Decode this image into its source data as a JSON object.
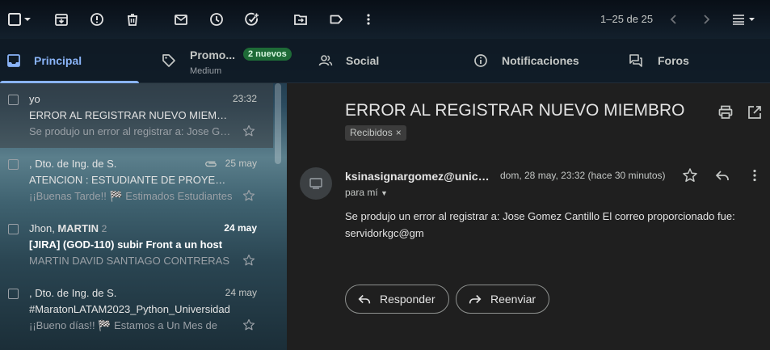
{
  "toolbar": {
    "icons": [
      "checkbox-icon",
      "chevron-down-icon",
      "archive-icon",
      "report-spam-icon",
      "delete-icon",
      "mark-unread-icon",
      "snooze-icon",
      "add-task-icon",
      "move-to-icon",
      "label-icon",
      "more-vert-icon"
    ],
    "pager_text": "1–25 de 25"
  },
  "tabs": [
    {
      "label": "Principal",
      "icon": "inbox-icon",
      "active": true
    },
    {
      "label": "Promo...",
      "icon": "tag-icon",
      "badge": "2 nuevos",
      "sublabel": "Medium"
    },
    {
      "label": "Social",
      "icon": "people-icon"
    },
    {
      "label": "Notificaciones",
      "icon": "info-icon"
    },
    {
      "label": "Foros",
      "icon": "forum-icon"
    }
  ],
  "emails": [
    {
      "sender": "yo",
      "date": "23:32",
      "subject": "ERROR AL REGISTRAR NUEVO MIEMBRO",
      "snippet": "Se produjo un error al registrar a: Jose Gomez Cantillo",
      "selected": true
    },
    {
      "sender": ", Dto. de Ing. de S.",
      "date": "25 may",
      "subject": "ATENCION : ESTUDIANTE DE PROYECTO",
      "snippet": "¡¡Buenas Tarde!! 🏁 Estimados Estudiantes",
      "attachment": true
    },
    {
      "sender_plain": "Jhon, ",
      "sender_bold": "MARTIN",
      "count": "2",
      "date": "24 may",
      "date_bold": true,
      "subject": "[JIRA] (GOD-110) subir Front a un host",
      "subject_bold": true,
      "snippet": "MARTIN DAVID SANTIAGO CONTRERAS"
    },
    {
      "sender": ", Dto. de Ing. de S.",
      "date": "24 may",
      "subject": "#MaratonLATAM2023_Python_Universidad",
      "snippet": "¡¡Bueno días!! 🏁 Estamos a Un Mes de"
    }
  ],
  "reader": {
    "subject": "ERROR AL REGISTRAR NUEVO MIEMBRO",
    "label": "Recibidos",
    "label_close": "×",
    "from": "ksinasignargomez@unicesar.edu.co",
    "date": "dom, 28 may, 23:32 (hace 30 minutos)",
    "to": "para mí",
    "body": "Se produjo un error al registrar a: Jose Gomez Cantillo El correo proporcionado fue: servidorkgc@gm",
    "reply_label": "Responder",
    "forward_label": "Reenviar"
  }
}
